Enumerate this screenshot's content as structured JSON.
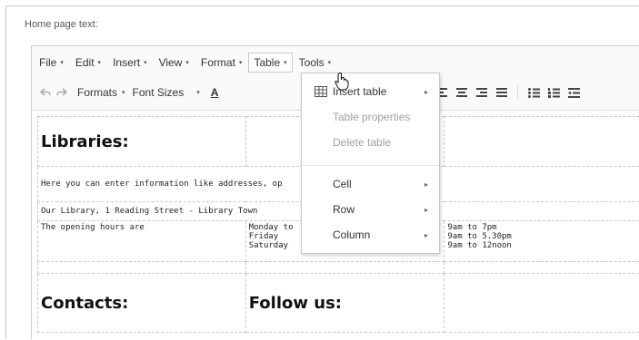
{
  "heading": "Home page text:",
  "menubar": {
    "items": [
      {
        "label": "File"
      },
      {
        "label": "Edit"
      },
      {
        "label": "Insert"
      },
      {
        "label": "View"
      },
      {
        "label": "Format"
      },
      {
        "label": "Table"
      },
      {
        "label": "Tools"
      }
    ],
    "caret": "▾"
  },
  "toolbar": {
    "formats_label": "Formats",
    "font_sizes_label": "Font Sizes",
    "font_color_letter": "A",
    "icons": [
      "undo-icon",
      "redo-icon",
      "font-color-icon",
      "align-left-icon",
      "align-center-icon",
      "align-right-icon",
      "align-justify-icon",
      "bullet-list-icon",
      "numbered-list-icon",
      "outdent-icon"
    ]
  },
  "table_menu": {
    "insert_table": "Insert table",
    "table_properties": "Table properties",
    "delete_table": "Delete table",
    "cell": "Cell",
    "row": "Row",
    "column": "Column",
    "submenu_arrow": "▸"
  },
  "content": {
    "libraries_heading": "Libraries:",
    "intro_text": "Here you can enter information like addresses, op",
    "address": "Our Library, 1 Reading Street - Library Town",
    "opening_label": "The opening hours are",
    "days": [
      "Monday to",
      "Friday",
      "Saturday"
    ],
    "hours": [
      "9am to 7pm",
      "9am to 5.30pm",
      "9am to 12noon"
    ],
    "contacts_heading": "Contacts:",
    "follow_heading": "Follow us:"
  },
  "colors": {
    "editor_background": "#fafafa",
    "menu_border": "#c8c8c8",
    "disabled_text": "#a0a0a0"
  }
}
